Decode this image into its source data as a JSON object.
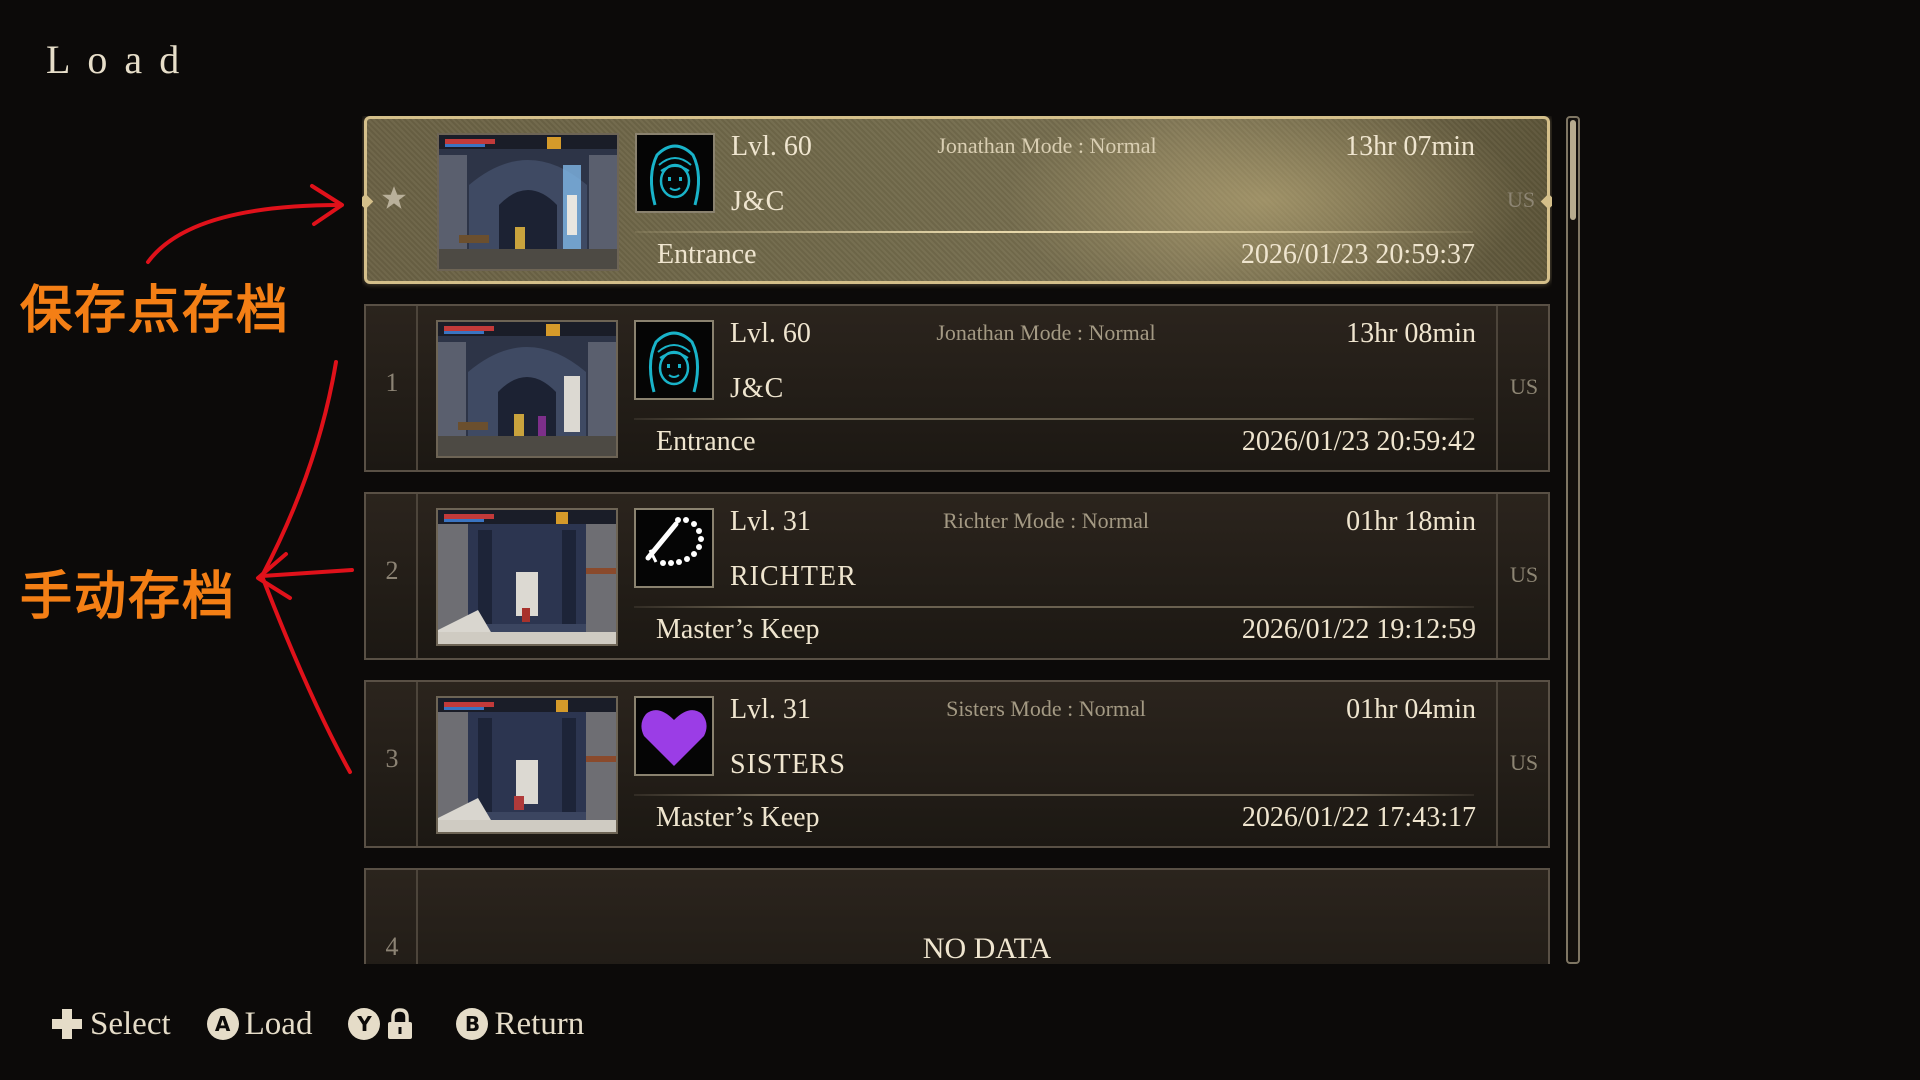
{
  "screen": {
    "title": "Load"
  },
  "slots": [
    {
      "index": "",
      "is_autosave": true,
      "level": "Lvl. 60",
      "mode": "Jonathan Mode : Normal",
      "playtime": "13hr 07min",
      "name": "J&C",
      "location": "Entrance",
      "datetime": "2026/01/23 20:59:37",
      "region": "US",
      "portrait": "jonathan-portrait-icon"
    },
    {
      "index": "1",
      "level": "Lvl. 60",
      "mode": "Jonathan Mode : Normal",
      "playtime": "13hr 08min",
      "name": "J&C",
      "location": "Entrance",
      "datetime": "2026/01/23 20:59:42",
      "region": "US",
      "portrait": "jonathan-portrait-icon"
    },
    {
      "index": "2",
      "level": "Lvl. 31",
      "mode": "Richter Mode : Normal",
      "playtime": "01hr 18min",
      "name": "RICHTER",
      "location": "Master’s Keep",
      "datetime": "2026/01/22 19:12:59",
      "region": "US",
      "portrait": "rosary-icon"
    },
    {
      "index": "3",
      "level": "Lvl. 31",
      "mode": "Sisters Mode : Normal",
      "playtime": "01hr 04min",
      "name": "SISTERS",
      "location": "Master’s Keep",
      "datetime": "2026/01/22 17:43:17",
      "region": "US",
      "portrait": "purple-heart-icon"
    },
    {
      "index": "4",
      "empty_label": "NO DATA"
    }
  ],
  "annotations": {
    "save_point": "保存点存档",
    "manual_save": "手动存档",
    "color": "#f47f15",
    "arrow_color": "#e0111a"
  },
  "hints": {
    "select": {
      "icon": "dpad-icon",
      "label": "Select"
    },
    "load": {
      "icon": "a-button-icon",
      "button": "A",
      "label": "Load"
    },
    "lock": {
      "icon": "y-button-icon",
      "button": "Y",
      "extra_icon": "lock-icon"
    },
    "return": {
      "icon": "b-button-icon",
      "button": "B",
      "label": "Return"
    }
  },
  "colors": {
    "background": "#0c0a09",
    "selected_border": "#d4bf8a",
    "text": "#efe5cf",
    "slot_border": "#595045"
  }
}
